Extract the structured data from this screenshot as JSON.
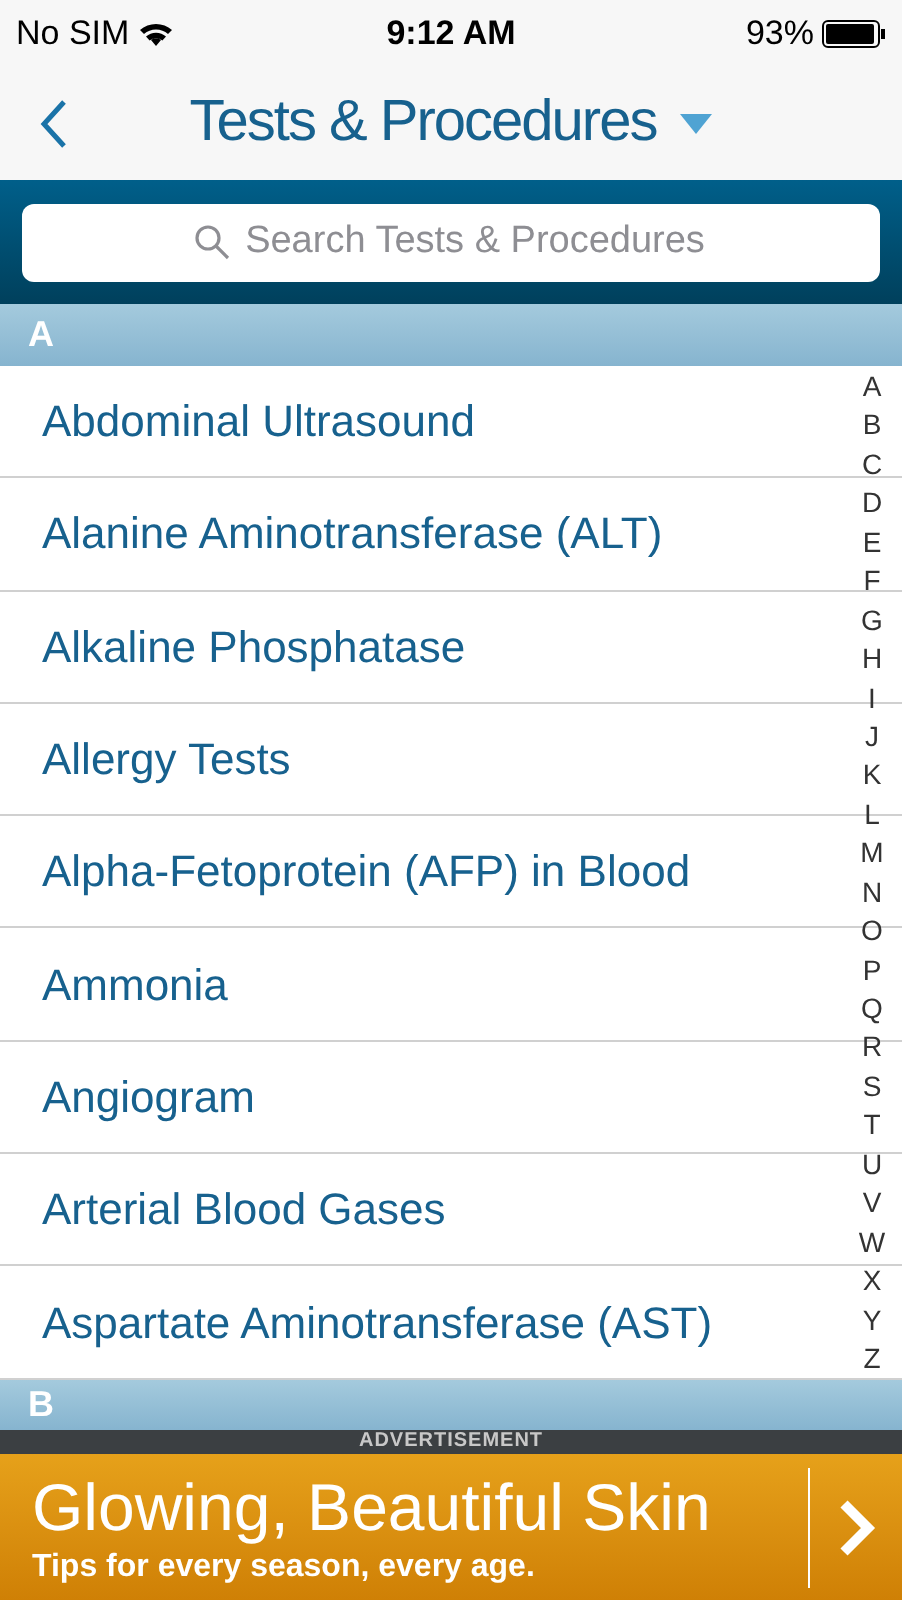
{
  "status_bar": {
    "carrier": "No SIM",
    "time": "9:12 AM",
    "battery": "93%"
  },
  "nav": {
    "title": "Tests & Procedures"
  },
  "search": {
    "placeholder": "Search Tests & Procedures"
  },
  "sections": [
    {
      "letter": "A",
      "items": [
        "Abdominal Ultrasound",
        "Alanine Aminotransferase (ALT)",
        "Alkaline Phosphatase",
        "Allergy Tests",
        "Alpha-Fetoprotein (AFP) in Blood",
        "Ammonia",
        "Angiogram",
        "Arterial Blood Gases",
        "Aspartate Aminotransferase (AST)"
      ]
    },
    {
      "letter": "B"
    }
  ],
  "index": [
    "A",
    "B",
    "C",
    "D",
    "E",
    "F",
    "G",
    "H",
    "I",
    "J",
    "K",
    "L",
    "M",
    "N",
    "O",
    "P",
    "Q",
    "R",
    "S",
    "T",
    "U",
    "V",
    "W",
    "X",
    "Y",
    "Z"
  ],
  "ad": {
    "label": "ADVERTISEMENT",
    "headline": "Glowing, Beautiful Skin",
    "tagline": "Tips for every season, every age."
  }
}
